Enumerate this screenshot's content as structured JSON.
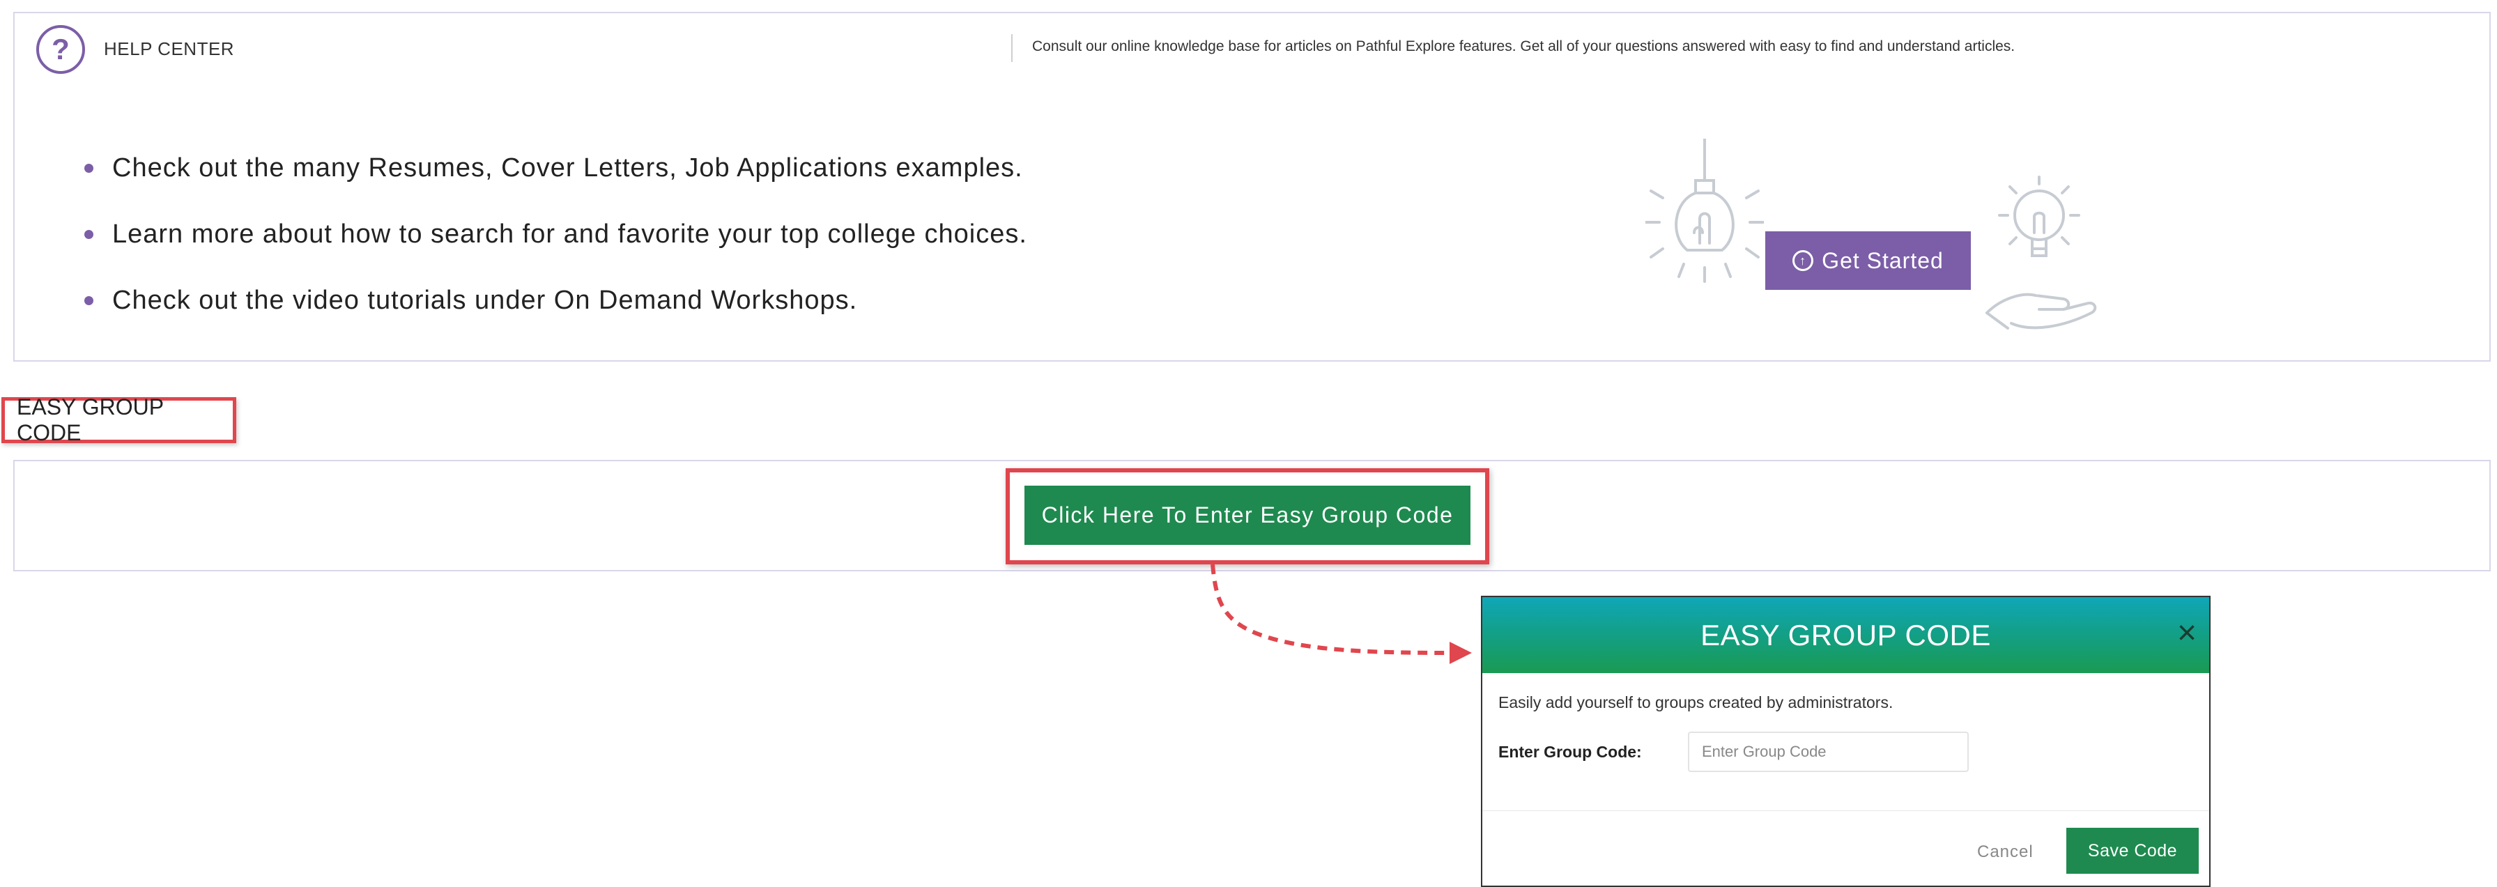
{
  "help_center": {
    "icon": "question-mark-icon",
    "icon_glyph": "?",
    "title": "HELP CENTER",
    "description": "Consult our online knowledge base for articles on Pathful Explore features. Get all of your questions answered with easy to find and understand articles.",
    "bullets": [
      "Check out the many Resumes, Cover Letters, Job Applications examples.",
      "Learn more about how to search for and favorite your top college choices.",
      "Check out the video tutorials under On Demand Workshops."
    ],
    "get_started_label": "Get Started",
    "get_started_icon": "arrow-up-circle-icon"
  },
  "easy_group_code": {
    "section_label": "EASY GROUP CODE",
    "button_label": "Click Here To Enter Easy Group Code"
  },
  "modal": {
    "title": "EASY GROUP CODE",
    "close_glyph": "×",
    "description": "Easily add yourself to groups created by administrators.",
    "field_label": "Enter Group Code:",
    "field_placeholder": "Enter Group Code",
    "field_value": "",
    "cancel_label": "Cancel",
    "save_label": "Save Code"
  },
  "colors": {
    "accent_purple": "#7b5ea7",
    "button_green": "#1e8a4f",
    "highlight_red": "#e0464d",
    "header_gradient_top": "#10a6b8",
    "header_gradient_bottom": "#1a9a52",
    "illustration_gray": "#c7ccd3"
  }
}
